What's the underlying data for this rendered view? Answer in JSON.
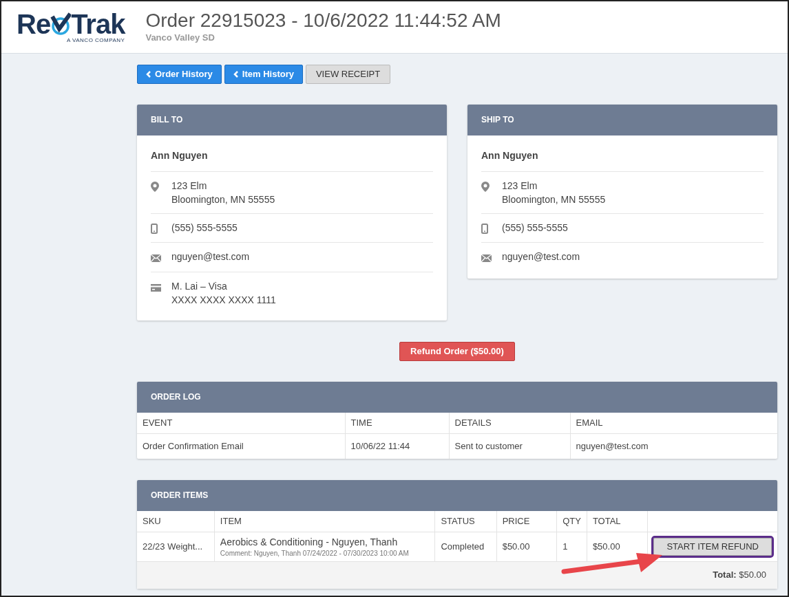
{
  "logo": {
    "text_left": "Re",
    "text_right": "Trak",
    "tagline": "A VANCO COMPANY"
  },
  "header": {
    "title": "Order 22915023 - 10/6/2022 11:44:52 AM",
    "subtitle": "Vanco Valley SD"
  },
  "nav_buttons": [
    {
      "label": "Order History",
      "kind": "back"
    },
    {
      "label": "Item History",
      "kind": "back"
    },
    {
      "label": "VIEW RECEIPT",
      "kind": "plain"
    }
  ],
  "address_cards": [
    {
      "title": "BILL TO",
      "name": "Ann Nguyen",
      "rows": [
        {
          "kind": "address",
          "lines": [
            "123 Elm",
            "Bloomington, MN 55555"
          ]
        },
        {
          "kind": "phone",
          "lines": [
            "(555) 555-5555"
          ]
        },
        {
          "kind": "email",
          "lines": [
            "nguyen@test.com"
          ]
        },
        {
          "kind": "card",
          "lines": [
            "M. Lai – Visa",
            "XXXX XXXX XXXX 1111"
          ]
        }
      ]
    },
    {
      "title": "SHIP TO",
      "name": "Ann Nguyen",
      "rows": [
        {
          "kind": "address",
          "lines": [
            "123 Elm",
            "Bloomington, MN 55555"
          ]
        },
        {
          "kind": "phone",
          "lines": [
            "(555) 555-5555"
          ]
        },
        {
          "kind": "email",
          "lines": [
            "nguyen@test.com"
          ]
        }
      ]
    }
  ],
  "refund_order_button": {
    "label": "Refund Order ($50.00)"
  },
  "order_log": {
    "title": "ORDER LOG",
    "columns": [
      "EVENT",
      "TIME",
      "DETAILS",
      "EMAIL"
    ],
    "rows": [
      [
        "Order Confirmation Email",
        "10/06/22 11:44",
        "Sent to customer",
        "nguyen@test.com"
      ]
    ]
  },
  "order_items": {
    "title": "ORDER ITEMS",
    "columns": [
      "SKU",
      "ITEM",
      "STATUS",
      "PRICE",
      "QTY",
      "TOTAL"
    ],
    "rows": [
      {
        "sku": "22/23 Weight...",
        "item": "Aerobics & Conditioning - Nguyen, Thanh",
        "comment": "Comment: Nguyen, Thanh 07/24/2022 - 07/30/2023 10:00 AM",
        "status": "Completed",
        "price": "$50.00",
        "qty": "1",
        "total": "$50.00",
        "action": {
          "label": "START ITEM REFUND",
          "highlighted": true
        }
      }
    ],
    "total": "**Total:** $50.00"
  }
}
